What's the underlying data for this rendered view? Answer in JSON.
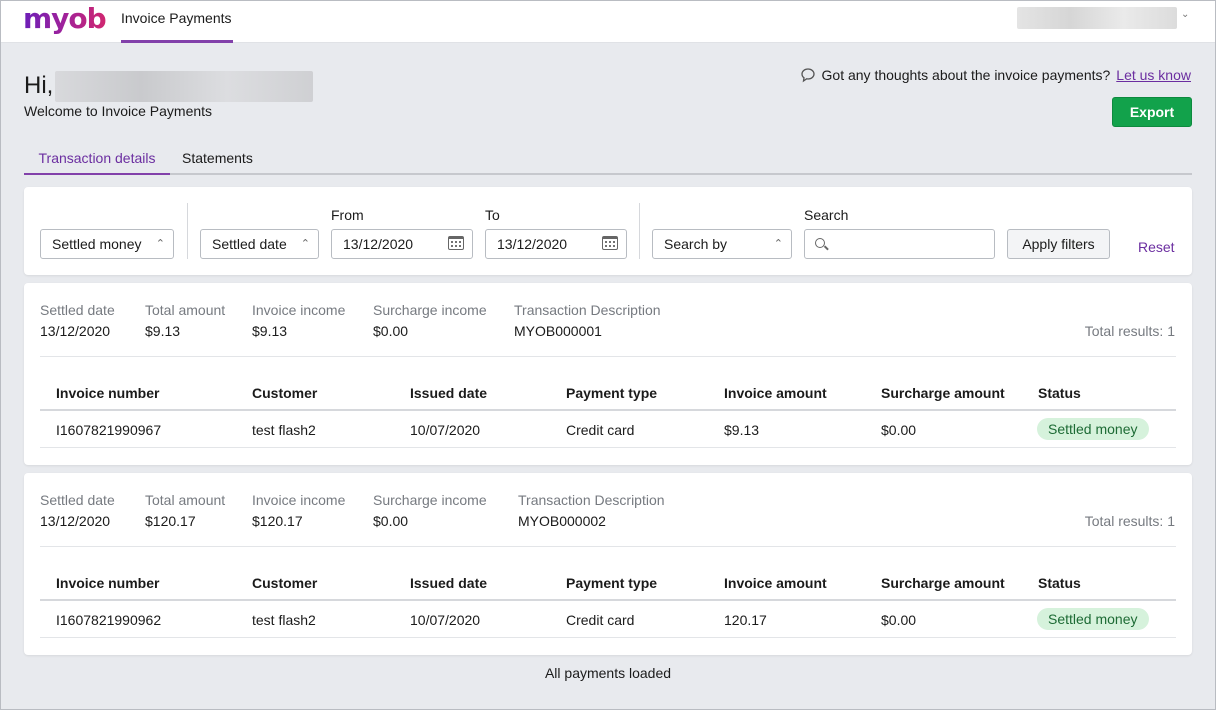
{
  "app": {
    "logo": "myob",
    "nav_tab": "Invoice Payments"
  },
  "greeting": {
    "hi": "Hi,",
    "welcome": "Welcome to Invoice Payments"
  },
  "feedback": {
    "text": "Got any thoughts about the invoice payments?",
    "link": "Let us know"
  },
  "export_label": "Export",
  "tabs": [
    {
      "label": "Transaction details",
      "active": true
    },
    {
      "label": "Statements",
      "active": false
    }
  ],
  "filters": {
    "money_select": "Settled money",
    "date_select": "Settled date",
    "from_label": "From",
    "from_value": "13/12/2020",
    "to_label": "To",
    "to_value": "13/12/2020",
    "search_by": "Search by",
    "search_label": "Search",
    "search_value": "",
    "apply_label": "Apply filters",
    "reset_label": "Reset"
  },
  "summary_labels": {
    "settled_date": "Settled date",
    "total_amount": "Total amount",
    "invoice_income": "Invoice income",
    "surcharge_income": "Surcharge income",
    "description": "Transaction Description"
  },
  "table_headers": {
    "invoice_number": "Invoice number",
    "customer": "Customer",
    "issued_date": "Issued date",
    "payment_type": "Payment type",
    "invoice_amount": "Invoice amount",
    "surcharge_amount": "Surcharge amount",
    "status": "Status"
  },
  "transactions": [
    {
      "settled_date": "13/12/2020",
      "total_amount": "$9.13",
      "invoice_income": "$9.13",
      "surcharge_income": "$0.00",
      "description": "MYOB000001",
      "total_results": "Total results: 1",
      "row": {
        "invoice_number": "I1607821990967",
        "customer": "test flash2",
        "issued_date": "10/07/2020",
        "payment_type": "Credit card",
        "invoice_amount": "$9.13",
        "surcharge_amount": "$0.00",
        "status": "Settled money"
      }
    },
    {
      "settled_date": "13/12/2020",
      "total_amount": "$120.17",
      "invoice_income": "$120.17",
      "surcharge_income": "$0.00",
      "description": "MYOB000002",
      "total_results": "Total results: 1",
      "row": {
        "invoice_number": "I1607821990962",
        "customer": "test flash2",
        "issued_date": "10/07/2020",
        "payment_type": "Credit card",
        "invoice_amount": "120.17",
        "surcharge_amount": "$0.00",
        "status": "Settled money"
      }
    }
  ],
  "footer": "All payments loaded",
  "colors": {
    "brand_purple": "#8241aa",
    "export_green": "#12a24b",
    "badge_bg": "#d6f2dc",
    "badge_text": "#1d6b35"
  }
}
